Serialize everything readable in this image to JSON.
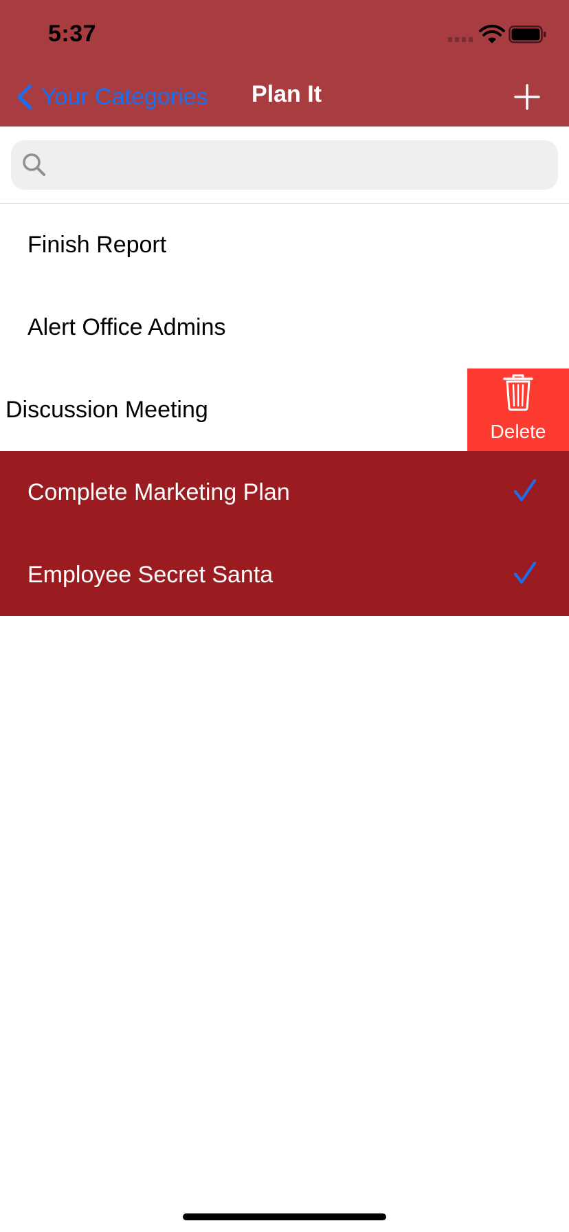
{
  "status_bar": {
    "time": "5:37"
  },
  "nav": {
    "back_label": "Your Categories",
    "title": "Plan It",
    "icons": {
      "back": "chevron-left-icon",
      "add": "plus-icon"
    }
  },
  "search": {
    "placeholder": "",
    "value": "",
    "icon": "search-icon"
  },
  "items": [
    {
      "title": "Finish Report",
      "done": false
    },
    {
      "title": "Alert Office Admins",
      "done": false
    },
    {
      "title": "Discussion Meeting",
      "done": false
    },
    {
      "title": "Complete Marketing Plan",
      "done": true
    },
    {
      "title": "Employee Secret Santa",
      "done": true
    }
  ],
  "swipe_action": {
    "label": "Delete",
    "icon": "trash-icon"
  },
  "colors": {
    "nav_background": "#a73c41",
    "done_row_background": "#9b1c20",
    "delete_background": "#fe3b30",
    "accent_blue": "#1a6ff0"
  }
}
